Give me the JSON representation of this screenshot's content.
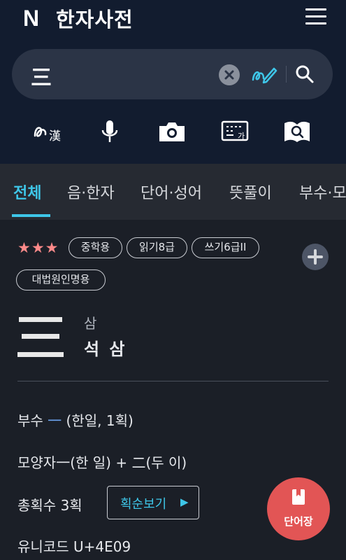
{
  "header": {
    "logo": "N",
    "title": "한자사전"
  },
  "search": {
    "value": "三"
  },
  "tools": [
    "handwriting-hanja-icon",
    "microphone-icon",
    "camera-icon",
    "keyboard-icon",
    "book-search-icon"
  ],
  "tabs": [
    {
      "label": "전체",
      "active": true
    },
    {
      "label": "음·한자"
    },
    {
      "label": "단어·성어"
    },
    {
      "label": "뜻풀이"
    },
    {
      "label": "부수·모양"
    }
  ],
  "entry": {
    "stars": "★★★",
    "badges": [
      "중학용",
      "읽기8급",
      "쓰기6급II",
      "대법원인명용"
    ],
    "character": "三",
    "reading": "삼",
    "meaning": "석 삼"
  },
  "details": {
    "radical_label": "부수",
    "radical_char": "一",
    "radical_desc": " (한일, 1획)",
    "shape_label": "모양자",
    "shape_value": "一(한 일) + 二(두 이)",
    "strokes_label": "총획수",
    "strokes_value": "3획",
    "stroke_button": "획순보기",
    "unicode_label": "유니코드",
    "unicode_value": "U+4E09"
  },
  "fab": {
    "label": "단어장"
  },
  "colors": {
    "accent": "#3ec6e8",
    "star": "#ff8a8a",
    "fab": "#e25555",
    "header_bg": "#121c2f",
    "body_bg": "#1b1f27"
  }
}
